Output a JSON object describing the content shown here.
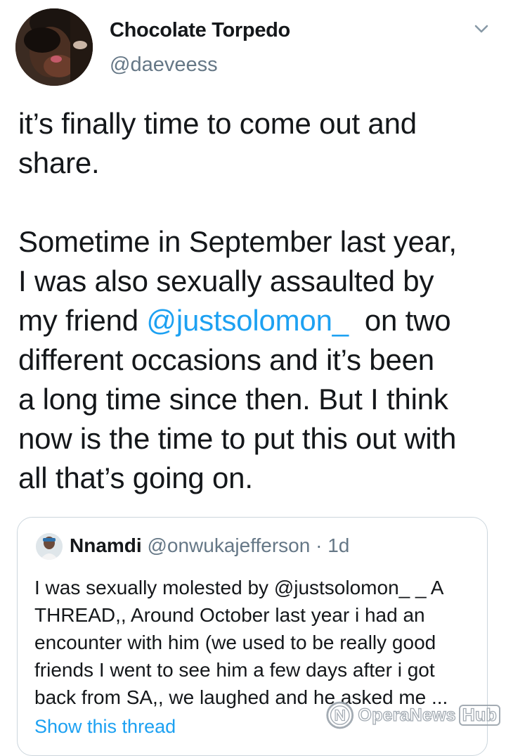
{
  "author": {
    "display_name": "Chocolate Torpedo",
    "handle": "@daeveess",
    "avatar": "profile-photo",
    "menu_icon": "chevron-down-icon"
  },
  "tweet": {
    "lines": [
      "it’s finally time to come out and",
      "share.",
      "",
      "Sometime in September last year,",
      "I was also sexually assaulted by",
      "my friend ",
      " on two",
      "different occasions and it’s been",
      "a long time since then. But I think",
      "now is the time to put this out with",
      "all that’s going on."
    ],
    "mention": "@justsolomon_"
  },
  "quote": {
    "name": "Nnamdi",
    "handle": "@onwukajefferson",
    "separator": "·",
    "time": "1d",
    "lines": [
      "I was sexually molested by @justsolomon_ _ A",
      "THREAD,, Around October last year i had an",
      "encounter with him (we used to be really good",
      "friends I went to see him a few days  after i got",
      "back from SA,,  we laughed and he asked me ..."
    ],
    "show_thread": "Show this thread"
  },
  "watermark": {
    "text": "OperaNews",
    "hub": "Hub"
  },
  "colors": {
    "link": "#1da1f2",
    "secondary_text": "#657786",
    "primary_text": "#14171a",
    "border": "#ccd6dd"
  }
}
